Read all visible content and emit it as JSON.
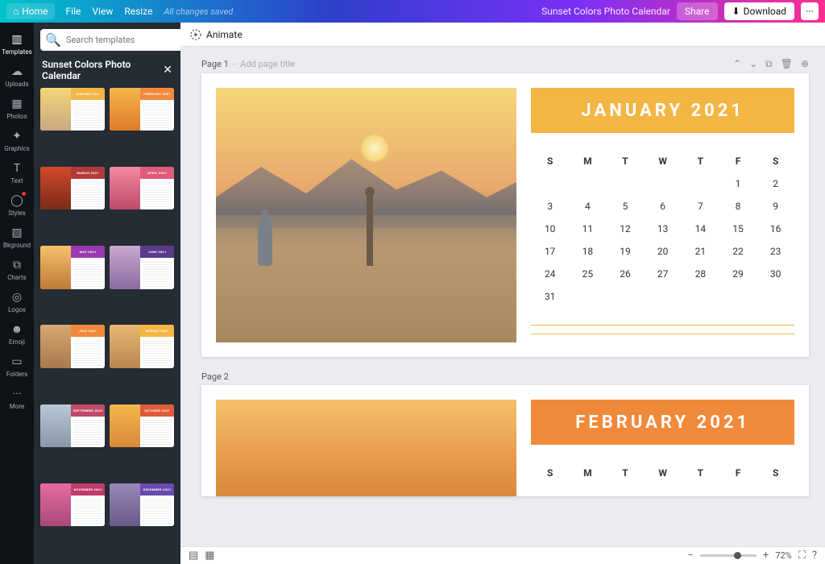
{
  "topbar": {
    "home": "Home",
    "file": "File",
    "view": "View",
    "resize": "Resize",
    "autosave": "All changes saved",
    "doc_name": "Sunset Colors Photo Calendar",
    "share": "Share",
    "download": "Download",
    "more": "···"
  },
  "rail": [
    {
      "icon": "▥",
      "label": "Templates",
      "active": true
    },
    {
      "icon": "☁",
      "label": "Uploads"
    },
    {
      "icon": "▦",
      "label": "Photos"
    },
    {
      "icon": "✦",
      "label": "Graphics"
    },
    {
      "icon": "T",
      "label": "Text"
    },
    {
      "icon": "◯",
      "label": "Styles",
      "badge": true
    },
    {
      "icon": "▨",
      "label": "Bkground"
    },
    {
      "icon": "⧉",
      "label": "Charts"
    },
    {
      "icon": "◎",
      "label": "Logos"
    },
    {
      "icon": "☻",
      "label": "Emoji"
    },
    {
      "icon": "▭",
      "label": "Folders"
    },
    {
      "icon": "···",
      "label": "More"
    }
  ],
  "panel": {
    "search_placeholder": "Search templates",
    "title": "Sunset Colors Photo Calendar",
    "thumbs": [
      {
        "label": "JANUARY 2021",
        "hdr": "#f3b544",
        "img": "linear-gradient(180deg,#f5d67a,#c8a880)"
      },
      {
        "label": "FEBRUARY 2021",
        "hdr": "#f08a3a",
        "img": "linear-gradient(180deg,#f5b64a,#e07a2a)"
      },
      {
        "label": "MARCH 2021",
        "hdr": "#b33a3a",
        "img": "linear-gradient(180deg,#d24a2a,#7a2a1a)"
      },
      {
        "label": "APRIL 2021",
        "hdr": "#e05a7a",
        "img": "linear-gradient(180deg,#f08aa0,#c04a6a)"
      },
      {
        "label": "MAY 2021",
        "hdr": "#9a3ab0",
        "img": "linear-gradient(180deg,#f5c26b,#c07a3a)"
      },
      {
        "label": "JUNE 2021",
        "hdr": "#5a3a8a",
        "img": "linear-gradient(180deg,#c8aad0,#8a6aa0)"
      },
      {
        "label": "JULY 2021",
        "hdr": "#f08a3a",
        "img": "linear-gradient(180deg,#d8a870,#a87850)"
      },
      {
        "label": "AUGUST 2021",
        "hdr": "#f3b544",
        "img": "linear-gradient(180deg,#e8b870,#b88850)"
      },
      {
        "label": "SEPTEMBER 2021",
        "hdr": "#c04a6a",
        "img": "linear-gradient(180deg,#b8c8d8,#8898a8)"
      },
      {
        "label": "OCTOBER 2021",
        "hdr": "#e05a3a",
        "img": "linear-gradient(180deg,#f5b64a,#d88a3a)"
      },
      {
        "label": "NOVEMBER 2021",
        "hdr": "#c03a6a",
        "img": "linear-gradient(180deg,#e86aa0,#a84a7a)"
      },
      {
        "label": "DECEMBER 2021",
        "hdr": "#6a4ab0",
        "img": "linear-gradient(180deg,#9888b8,#6a5a8a)"
      }
    ]
  },
  "toolbar": {
    "animate": "Animate"
  },
  "pages": {
    "page1_label": "Page 1",
    "page1_hint": "Add page title",
    "page2_label": "Page 2",
    "january": {
      "title": "JANUARY 2021",
      "header_color": "#f3b544",
      "dow": [
        "S",
        "M",
        "T",
        "W",
        "T",
        "F",
        "S"
      ],
      "cells": [
        "",
        "",
        "",
        "",
        "",
        "1",
        "2",
        "3",
        "4",
        "5",
        "6",
        "7",
        "8",
        "9",
        "10",
        "11",
        "12",
        "13",
        "14",
        "15",
        "16",
        "17",
        "18",
        "19",
        "20",
        "21",
        "22",
        "23",
        "24",
        "25",
        "26",
        "27",
        "28",
        "29",
        "30",
        "31"
      ]
    },
    "february": {
      "title": "FEBRUARY 2021",
      "header_color": "#f08a3a",
      "dow": [
        "S",
        "M",
        "T",
        "W",
        "T",
        "F",
        "S"
      ]
    }
  },
  "footer": {
    "zoom": "72%"
  }
}
